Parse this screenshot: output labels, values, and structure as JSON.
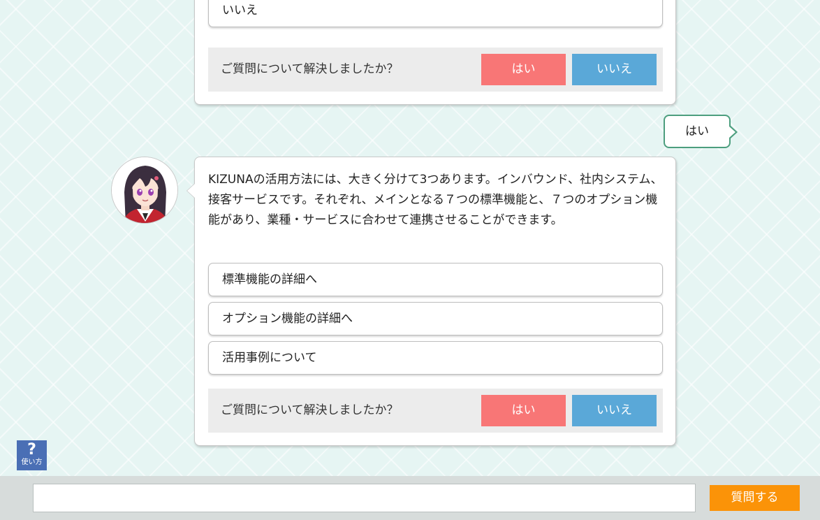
{
  "colors": {
    "background": "#e6f5f3",
    "yes_button": "#f87676",
    "no_button": "#5aa8d8",
    "user_bubble_border": "#4c9e7e",
    "ask_button": "#fb9308",
    "help_button": "#4a6fb5"
  },
  "chat": {
    "top_bubble": {
      "options": [
        "いいえ"
      ],
      "confirm_question": "ご質問について解決しましたか？",
      "yes_label": "はい",
      "no_label": "いいえ"
    },
    "user_message": "はい",
    "bot_message": {
      "text": "KIZUNAの活用方法には、大きく分けて3つあります。インバウンド、社内システム、接客サービスです。それぞれ、メインとなる７つの標準機能と、７つのオプション機能があり、業種・サービスに合わせて連携させることができます。",
      "options": [
        "標準機能の詳細へ",
        "オプション機能の詳細へ",
        "活用事例について"
      ],
      "confirm_question": "ご質問について解決しましたか？",
      "yes_label": "はい",
      "no_label": "いいえ"
    }
  },
  "help": {
    "icon": "question-mark-icon",
    "symbol": "?",
    "label": "使い方"
  },
  "footer": {
    "input_placeholder": "",
    "ask_label": "質問する"
  }
}
